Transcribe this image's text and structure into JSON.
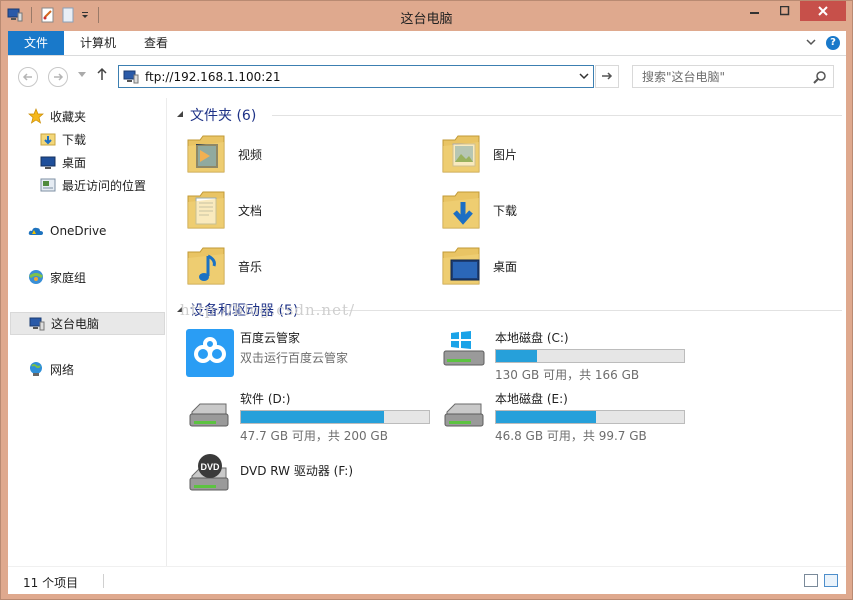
{
  "window": {
    "title": "这台电脑"
  },
  "ribbon": {
    "tabs": [
      "文件",
      "计算机",
      "查看"
    ]
  },
  "address_bar": {
    "path": "ftp://192.168.1.100:21",
    "search_placeholder": "搜索\"这台电脑\""
  },
  "nav_pane": {
    "favorites": "收藏夹",
    "downloads": "下载",
    "desktop": "桌面",
    "recent": "最近访问的位置",
    "onedrive": "OneDrive",
    "homegroup": "家庭组",
    "this_pc": "这台电脑",
    "network": "网络"
  },
  "folders_group": {
    "title": "文件夹 (6)",
    "items": [
      "视频",
      "图片",
      "文档",
      "下载",
      "音乐",
      "桌面"
    ]
  },
  "devices_group": {
    "title": "设备和驱动器 (5)",
    "items": [
      {
        "name": "百度云管家",
        "sub": "双击运行百度云管家"
      },
      {
        "name": "本地磁盘 (C:)",
        "sub": "130 GB 可用，共 166 GB",
        "used_fraction": 0.217
      },
      {
        "name": "软件 (D:)",
        "sub": "47.7 GB 可用，共 200 GB",
        "used_fraction": 0.762
      },
      {
        "name": "本地磁盘 (E:)",
        "sub": "46.8 GB 可用，共 99.7 GB",
        "used_fraction": 0.531
      },
      {
        "name": "DVD RW 驱动器 (F:)"
      }
    ]
  },
  "watermark": "http://blog.csdn.net/",
  "status_bar": {
    "item_count": "11 个项目"
  },
  "colors": {
    "accent": "#1979ca",
    "bar_fill": "#26a0da",
    "frame": "#dfa98e",
    "group_title": "#1e3287"
  }
}
